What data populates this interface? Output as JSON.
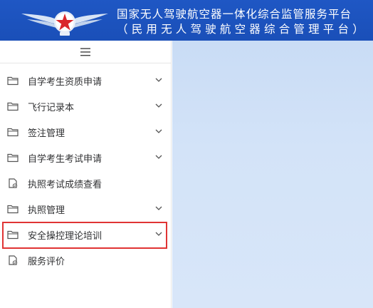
{
  "header": {
    "title_line1": "国家无人驾驶航空器一体化综合监管服务平台",
    "title_line2": "（民用无人驾驶航空器综合管理平台）",
    "logo": "wings-star-logo",
    "background_color": "#1f57c4"
  },
  "sidebar": {
    "toggle_icon": "hamburger-icon",
    "items": [
      {
        "label": "自学考生资质申请",
        "icon": "folder-icon",
        "expandable": true
      },
      {
        "label": "飞行记录本",
        "icon": "folder-icon",
        "expandable": true
      },
      {
        "label": "签注管理",
        "icon": "folder-icon",
        "expandable": true
      },
      {
        "label": "自学考生考试申请",
        "icon": "folder-icon",
        "expandable": true
      },
      {
        "label": "执照考试成绩查看",
        "icon": "document-icon",
        "expandable": false
      },
      {
        "label": "执照管理",
        "icon": "folder-icon",
        "expandable": true
      },
      {
        "label": "安全操控理论培训",
        "icon": "folder-icon",
        "expandable": true,
        "highlighted": true
      },
      {
        "label": "服务评价",
        "icon": "document-icon",
        "expandable": false
      }
    ],
    "highlight_color": "#e03434"
  },
  "main": {
    "background_color": "#d3e3f8"
  }
}
